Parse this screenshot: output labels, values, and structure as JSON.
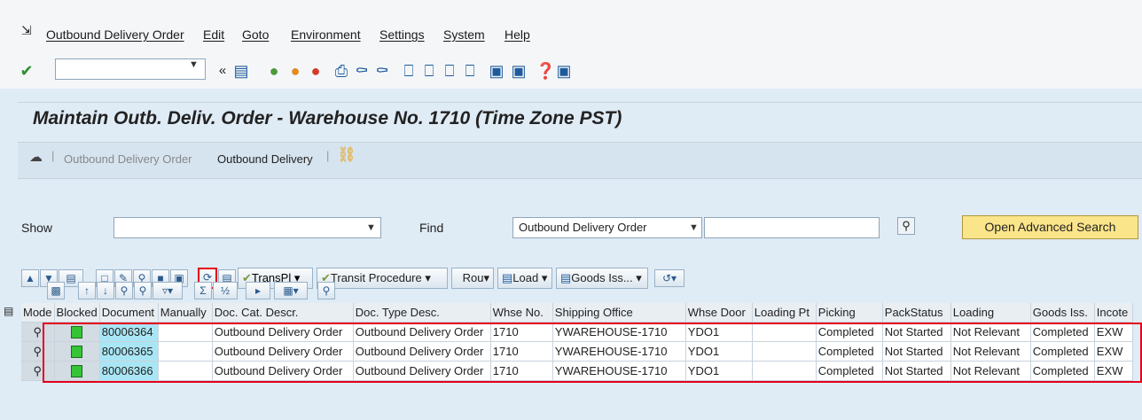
{
  "menu": {
    "items": [
      "Outbound Delivery Order",
      "Edit",
      "Goto",
      "Environment",
      "Settings",
      "System",
      "Help"
    ]
  },
  "toolbar": {
    "command_value": "",
    "icons": [
      "enter-icon",
      "back-nav-icon",
      "save-icon",
      "back-icon",
      "exit-icon",
      "cancel-icon",
      "print-icon",
      "find-icon",
      "find-next-icon",
      "first-page-icon",
      "prev-page-icon",
      "next-page-icon",
      "last-page-icon",
      "new-session-icon",
      "shortcut-icon",
      "help-icon",
      "customize-layout-icon"
    ]
  },
  "page": {
    "title": "Maintain Outb. Deliv. Order - Warehouse No. 1710 (Time Zone PST)"
  },
  "app_toolbar": {
    "item1": "Outbound Delivery Order",
    "item2": "Outbound Delivery"
  },
  "search": {
    "show_label": "Show",
    "show_value": "",
    "find_label": "Find",
    "find_value": "Outbound Delivery Order",
    "find_text": "",
    "advanced_button": "Open Advanced Search"
  },
  "grid_toolbar": {
    "transpl": "TransPl",
    "transit": "Transit Procedure",
    "rou": "Rou",
    "load": "Load",
    "goods_iss": "Goods Iss..."
  },
  "table": {
    "headers": [
      "Mode",
      "Blocked",
      "Document",
      "Manually",
      "Doc. Cat. Descr.",
      "Doc. Type Desc.",
      "Whse No.",
      "Shipping Office",
      "Whse Door",
      "Loading Pt",
      "Picking",
      "PackStatus",
      "Loading",
      "Goods Iss.",
      "Incote"
    ],
    "rows": [
      {
        "document": "80006364",
        "manually": "",
        "doc_cat": "Outbound Delivery Order",
        "doc_type": "Outbound Delivery Order",
        "whse_no": "1710",
        "shipping_office": "YWAREHOUSE-1710",
        "whse_door": "YDO1",
        "loading_pt": "",
        "picking": "Completed",
        "pack_status": "Not Started",
        "loading": "Not Relevant",
        "goods_iss": "Completed",
        "incote": "EXW"
      },
      {
        "document": "80006365",
        "manually": "",
        "doc_cat": "Outbound Delivery Order",
        "doc_type": "Outbound Delivery Order",
        "whse_no": "1710",
        "shipping_office": "YWAREHOUSE-1710",
        "whse_door": "YDO1",
        "loading_pt": "",
        "picking": "Completed",
        "pack_status": "Not Started",
        "loading": "Not Relevant",
        "goods_iss": "Completed",
        "incote": "EXW"
      },
      {
        "document": "80006366",
        "manually": "",
        "doc_cat": "Outbound Delivery Order",
        "doc_type": "Outbound Delivery Order",
        "whse_no": "1710",
        "shipping_office": "YWAREHOUSE-1710",
        "whse_door": "YDO1",
        "loading_pt": "",
        "picking": "Completed",
        "pack_status": "Not Started",
        "loading": "Not Relevant",
        "goods_iss": "Completed",
        "incote": "EXW"
      }
    ]
  },
  "colors": {
    "accent_yellow": "#fbe58a",
    "document_highlight": "#a9e6f5",
    "selection_border": "#e3001b",
    "status_green": "#35c435"
  }
}
